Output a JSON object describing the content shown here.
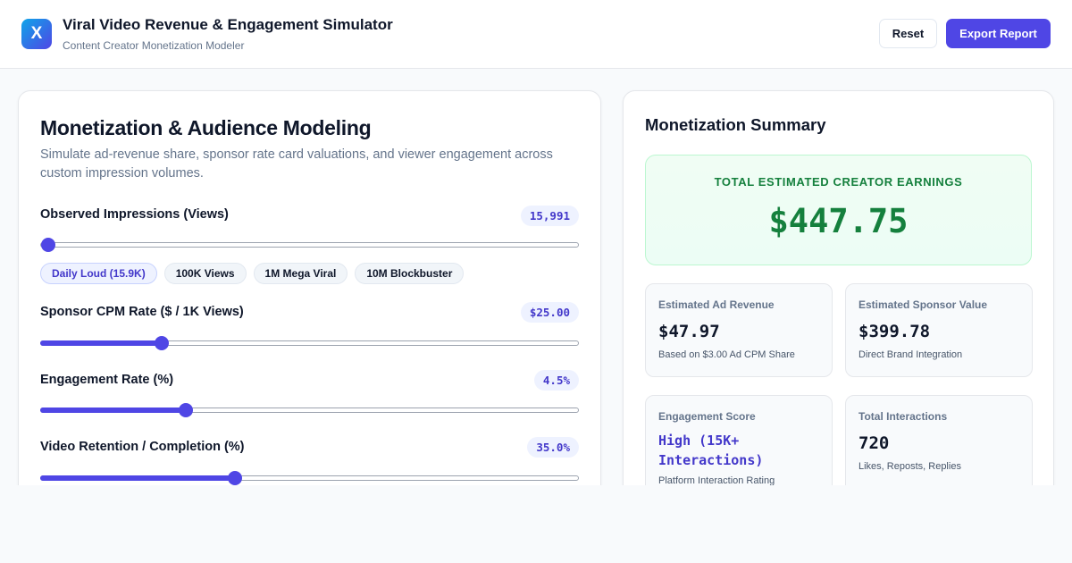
{
  "header": {
    "logo_letter": "X",
    "title": "Viral Video Revenue & Engagement Simulator",
    "subtitle": "Content Creator Monetization Modeler",
    "reset_label": "Reset",
    "export_label": "Export Report"
  },
  "modeling": {
    "title": "Monetization & Audience Modeling",
    "description": "Simulate ad-revenue share, sponsor rate card valuations, and viewer engagement across custom impression volumes.",
    "impressions": {
      "label": "Observed Impressions (Views)",
      "display": "15,991",
      "value": 15991,
      "min": 0,
      "max": 10000000,
      "presets": [
        {
          "label": "Daily Loud (15.9K)",
          "active": true
        },
        {
          "label": "100K Views",
          "active": false
        },
        {
          "label": "1M Mega Viral",
          "active": false
        },
        {
          "label": "10M Blockbuster",
          "active": false
        }
      ]
    },
    "cpm": {
      "label": "Sponsor CPM Rate ($ / 1K Views)",
      "display": "$25.00",
      "value": 25,
      "min": 0,
      "max": 115
    },
    "engagement": {
      "label": "Engagement Rate (%)",
      "display": "4.5%",
      "value": 4.5,
      "min": 0,
      "max": 17
    },
    "retention": {
      "label": "Video Retention / Completion (%)",
      "display": "35.0%",
      "value": 35,
      "min": 0,
      "max": 98
    }
  },
  "summary": {
    "title": "Monetization Summary",
    "total_label": "TOTAL ESTIMATED CREATOR EARNINGS",
    "total_value": "$447.75",
    "ad_revenue": {
      "label": "Estimated Ad Revenue",
      "value": "$47.97",
      "note": "Based on $3.00 Ad CPM Share"
    },
    "sponsor_value": {
      "label": "Estimated Sponsor Value",
      "value": "$399.78",
      "note": "Direct Brand Integration"
    },
    "engagement_score": {
      "label": "Engagement Score",
      "value": "High (15K+ Interactions)",
      "note": "Platform Interaction Rating"
    },
    "interactions": {
      "label": "Total Interactions",
      "value": "720",
      "note": "Likes, Reposts, Replies"
    }
  },
  "colors": {
    "accent": "#4f46e5",
    "success": "#15803d",
    "muted": "#64748b"
  }
}
